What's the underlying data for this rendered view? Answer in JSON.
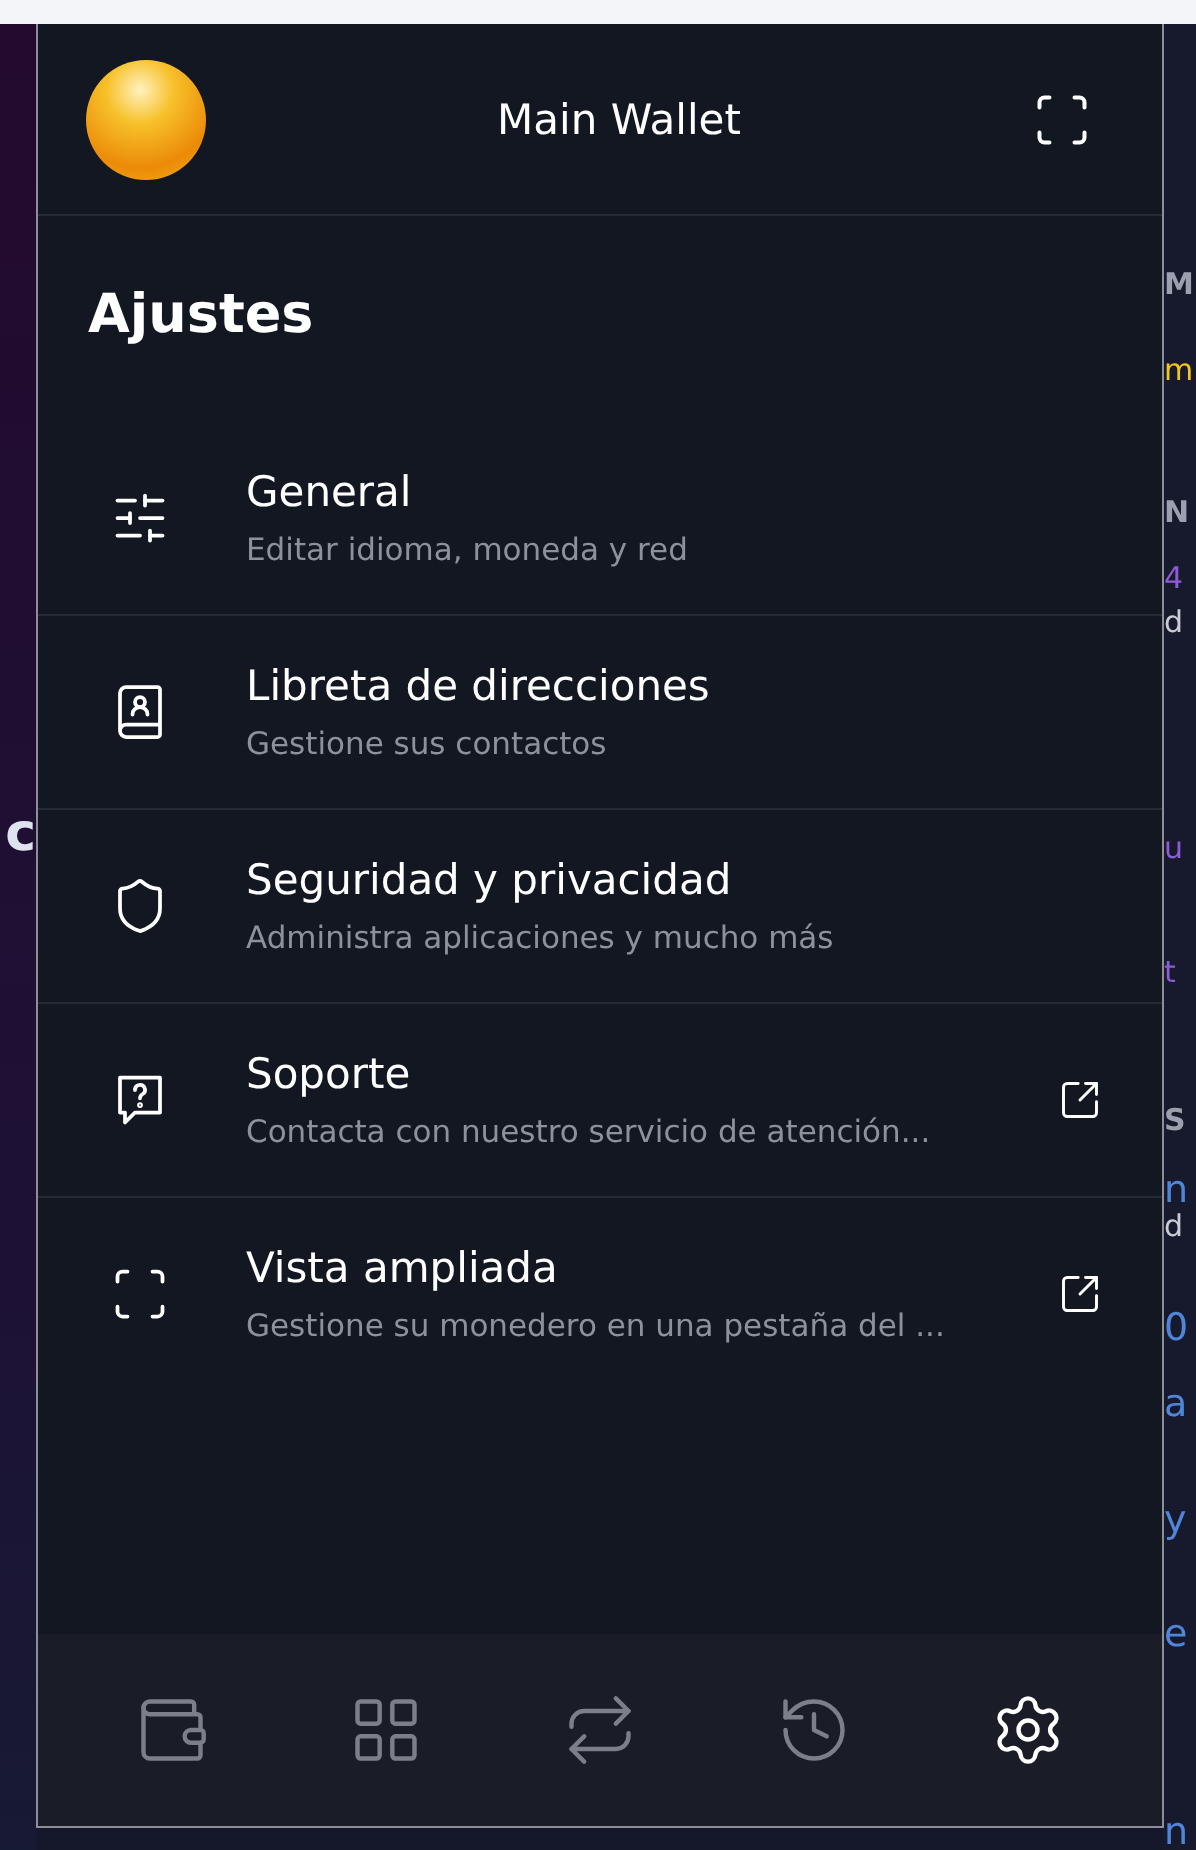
{
  "background": {
    "left_fragments": [
      {
        "text": "c",
        "color": "#dfe3f0"
      }
    ],
    "right_fragments": [
      {
        "text": "M",
        "color": "#9aa0ad"
      },
      {
        "text": "m",
        "color": "#f5c518"
      },
      {
        "text": "N",
        "color": "#9aa0ad"
      },
      {
        "text": "4",
        "color": "#8e5bd6"
      },
      {
        "text": "d",
        "color": "#c9ccd4"
      },
      {
        "text": "u",
        "color": "#8e5bd6"
      },
      {
        "text": "t",
        "color": "#8e5bd6"
      },
      {
        "text": "S",
        "color": "#9aa0ad"
      },
      {
        "text": "n",
        "color": "#4f86d9"
      },
      {
        "text": "d",
        "color": "#c9ccd4"
      },
      {
        "text": "0",
        "color": "#4f86d9"
      },
      {
        "text": "a",
        "color": "#4f86d9"
      },
      {
        "text": "y",
        "color": "#4f86d9"
      },
      {
        "text": "e",
        "color": "#4f86d9"
      },
      {
        "text": "n",
        "color": "#4f86d9"
      }
    ]
  },
  "header": {
    "title": "Main Wallet"
  },
  "page_title": "Ajustes",
  "items": [
    {
      "kind": "sliders",
      "title": "General",
      "subtitle": "Editar idioma, moneda y red",
      "external": false
    },
    {
      "kind": "contacts",
      "title": "Libreta de direcciones",
      "subtitle": "Gestione sus contactos",
      "external": false
    },
    {
      "kind": "shield",
      "title": "Seguridad y privacidad",
      "subtitle": "Administra aplicaciones y mucho más",
      "external": false
    },
    {
      "kind": "help",
      "title": "Soporte",
      "subtitle": "Contacta con nuestro servicio de atención...",
      "external": true
    },
    {
      "kind": "expand",
      "title": "Vista ampliada",
      "subtitle": "Gestione su monedero en una pestaña del ...",
      "external": true
    }
  ],
  "nav": [
    {
      "kind": "wallet",
      "selected": false
    },
    {
      "kind": "apps",
      "selected": false
    },
    {
      "kind": "swap",
      "selected": false
    },
    {
      "kind": "history",
      "selected": false
    },
    {
      "kind": "settings",
      "selected": true
    }
  ]
}
